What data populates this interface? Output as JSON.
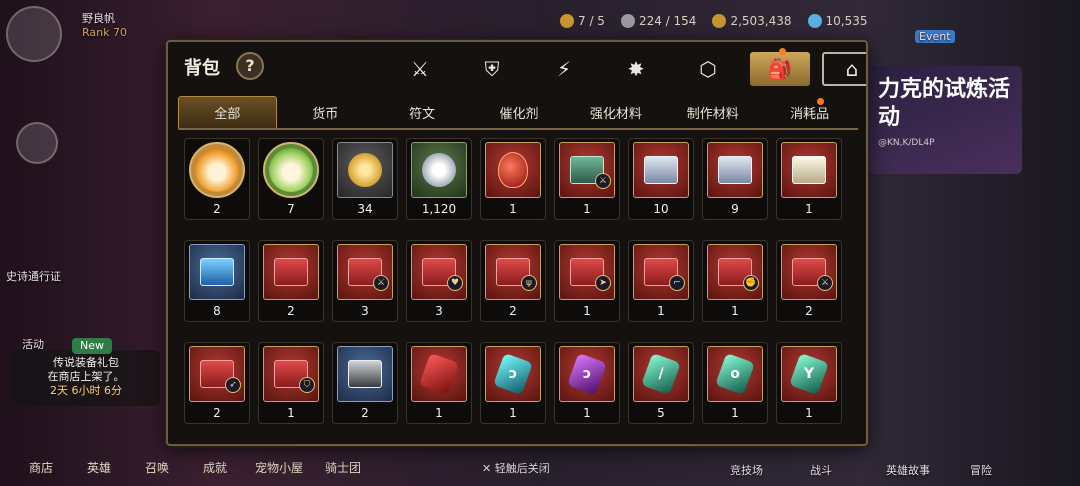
{
  "background": {
    "player_name": "野良帆",
    "rank": "Rank 70",
    "stats": [
      {
        "icon": "stamina-icon",
        "value": "7 / 5"
      },
      {
        "icon": "energy-icon",
        "value": "224 / 154"
      },
      {
        "icon": "gold-coin-icon",
        "value": "2,503,438"
      },
      {
        "icon": "crystal-icon",
        "value": "10,535"
      }
    ],
    "event_label": "Event",
    "side_label_1": "史诗通行证",
    "side_label_2": "活动",
    "promo": {
      "badge": "New",
      "line1": "传说装备礼包",
      "line2": "在商店上架了。",
      "line3": "2天 6小时 6分"
    },
    "bottom_nav": [
      "商店",
      "英雄",
      "召唤",
      "成就",
      "宠物小屋",
      "骑士团"
    ],
    "bottom_right": [
      "竞技场",
      "战斗",
      "英雄故事",
      "冒险"
    ],
    "banner": {
      "title": "力克的试炼活动",
      "subtitle": "@KN,K/DL4P"
    },
    "close_hint": "✕ 轻触后关闭"
  },
  "inventory": {
    "title": "背包",
    "help": "?",
    "category_icons": [
      "sword-shield-icon",
      "broken-shield-icon",
      "lightning-icon",
      "burst-icon",
      "dice-icon",
      "backpack-icon",
      "chest-icon"
    ],
    "active_category": 5,
    "tabs": [
      "全部",
      "货币",
      "符文",
      "催化剂",
      "强化材料",
      "制作材料",
      "消耗品"
    ],
    "active_tab": 0,
    "items": [
      {
        "name": "orange-hamster-coin",
        "qty": "2"
      },
      {
        "name": "green-hamster-coin",
        "qty": "7"
      },
      {
        "name": "gold-lotus",
        "qty": "34"
      },
      {
        "name": "silver-lotus",
        "qty": "1,120"
      },
      {
        "name": "red-potion",
        "qty": "1"
      },
      {
        "name": "teal-chest",
        "qty": "1"
      },
      {
        "name": "silver-chest-a",
        "qty": "10"
      },
      {
        "name": "silver-chest-b",
        "qty": "9"
      },
      {
        "name": "white-gold-chest",
        "qty": "1"
      },
      {
        "name": "blue-chest",
        "qty": "8"
      },
      {
        "name": "red-chest-1",
        "qty": "2"
      },
      {
        "name": "red-chest-sword",
        "qty": "3"
      },
      {
        "name": "red-chest-heart",
        "qty": "3"
      },
      {
        "name": "red-chest-trident",
        "qty": "2"
      },
      {
        "name": "red-chest-arrow",
        "qty": "1"
      },
      {
        "name": "red-chest-gun",
        "qty": "1"
      },
      {
        "name": "red-chest-muscle",
        "qty": "1"
      },
      {
        "name": "red-chest-sword-2",
        "qty": "2"
      },
      {
        "name": "red-chest-bow",
        "qty": "2"
      },
      {
        "name": "red-chest-shield",
        "qty": "1"
      },
      {
        "name": "dark-chest",
        "qty": "2"
      },
      {
        "name": "red-rune",
        "qty": "1"
      },
      {
        "name": "cyan-rune-1",
        "qty": "1"
      },
      {
        "name": "purple-rune",
        "qty": "1"
      },
      {
        "name": "teal-rune-1",
        "qty": "5"
      },
      {
        "name": "teal-rune-2",
        "qty": "1"
      },
      {
        "name": "teal-rune-3",
        "qty": "1"
      }
    ]
  }
}
